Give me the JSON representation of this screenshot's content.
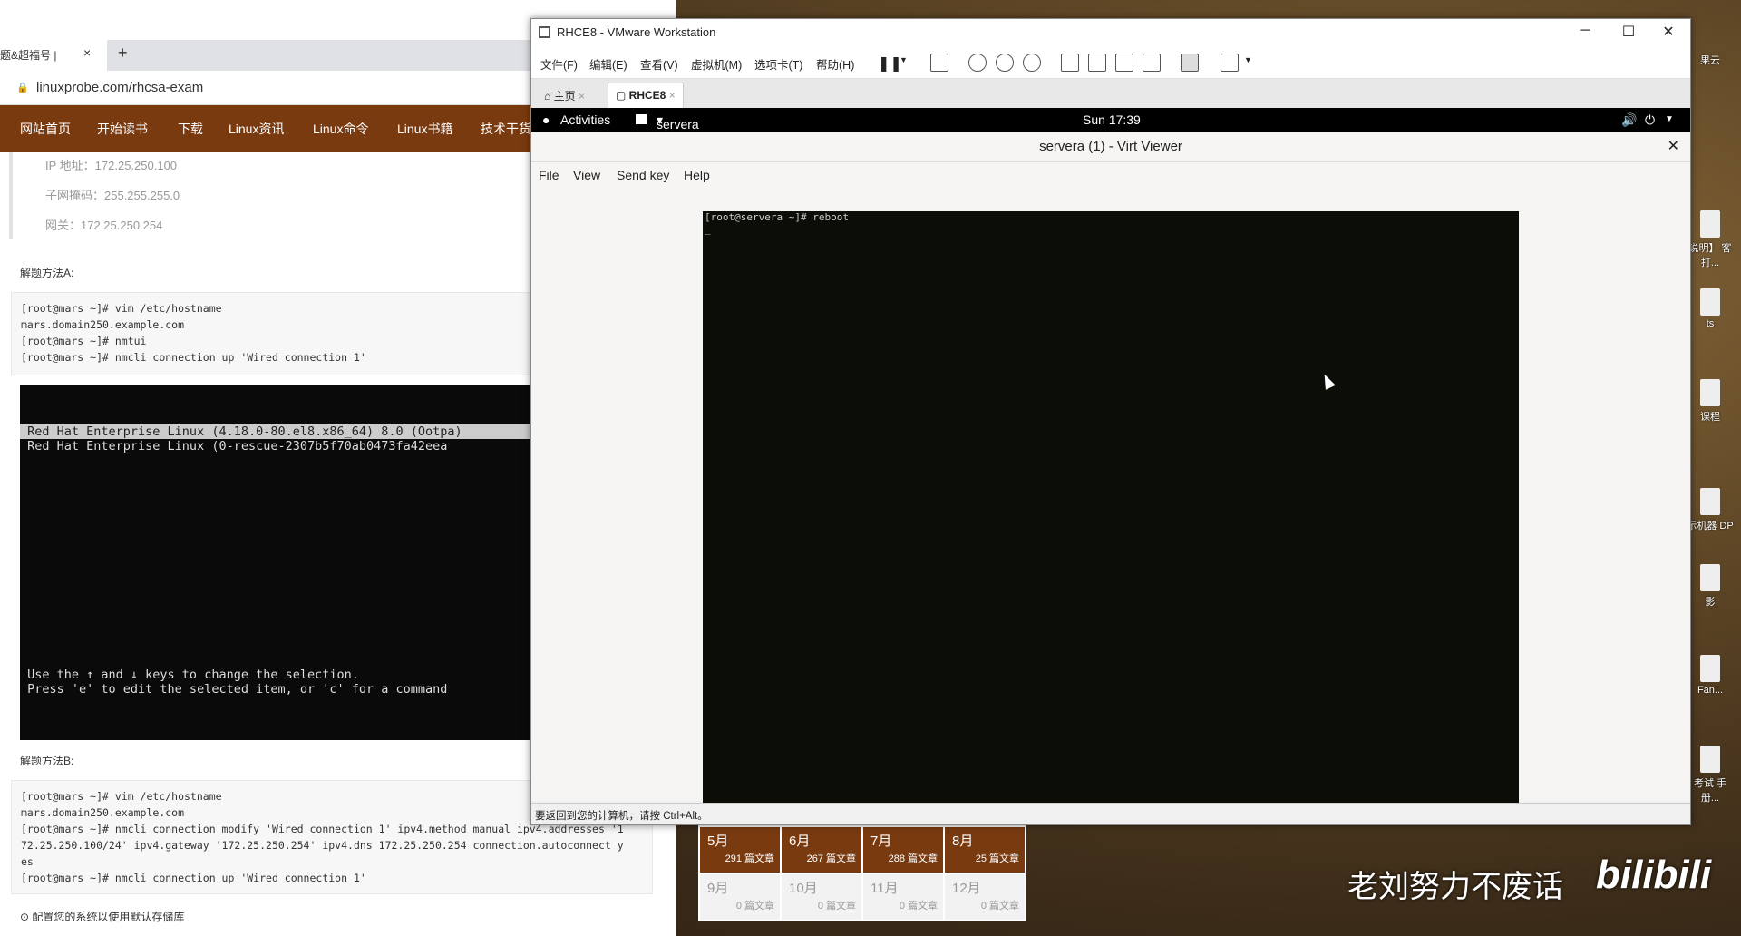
{
  "browser": {
    "tab_label": "题&超福号 |",
    "url": "linuxprobe.com/rhcsa-exam",
    "nav": [
      "网站首页",
      "开始读书",
      "下载",
      "Linux资讯",
      "Linux命令",
      "Linux书籍",
      "技术干货"
    ],
    "ip_rows": [
      "IP 地址：172.25.250.100",
      "子网掩码：255.255.255.0",
      "网关：172.25.250.254"
    ],
    "method_a_title": "解题方法A:",
    "method_a_code": "[root@mars ~]# vim /etc/hostname\nmars.domain250.example.com\n[root@mars ~]# nmtui\n[root@mars ~]# nmcli connection up 'Wired connection 1'",
    "grub_line1": " Red Hat Enterprise Linux (4.18.0-80.el8.x86_64) 8.0 (Ootpa)",
    "grub_line2": " Red Hat Enterprise Linux (0-rescue-2307b5f70ab0473fa42eea",
    "grub_help1": " Use the ↑ and ↓ keys to change the selection.",
    "grub_help2": " Press 'e' to edit the selected item, or 'c' for a command",
    "method_b_title": "解题方法B:",
    "method_b_code": "[root@mars ~]# vim /etc/hostname\nmars.domain250.example.com\n[root@mars ~]# nmcli connection modify 'Wired connection 1' ipv4.method manual ipv4.addresses '1\n72.25.250.100/24' ipv4.gateway '172.25.250.254' ipv4.dns 172.25.250.254 connection.autoconnect y\nes\n[root@mars ~]# nmcli connection up 'Wired connection 1'",
    "footer_note": "配置您的系统以使用默认存储库"
  },
  "calendar": [
    {
      "month": "5月",
      "count": "291 篇文章"
    },
    {
      "month": "6月",
      "count": "267 篇文章"
    },
    {
      "month": "7月",
      "count": "288 篇文章"
    },
    {
      "month": "8月",
      "count": "25 篇文章"
    },
    {
      "month": "9月",
      "count": "0 篇文章"
    },
    {
      "month": "10月",
      "count": "0 篇文章"
    },
    {
      "month": "11月",
      "count": "0 篇文章"
    },
    {
      "month": "12月",
      "count": "0 篇文章"
    }
  ],
  "vmware": {
    "title": "RHCE8 - VMware Workstation",
    "menu": [
      "文件(F)",
      "编辑(E)",
      "查看(V)",
      "虚拟机(M)",
      "选项卡(T)",
      "帮助(H)"
    ],
    "tabs": [
      "主页",
      "RHCE8"
    ],
    "status": "要返回到您的计算机，请按 Ctrl+Alt。"
  },
  "gnome": {
    "activities": "Activities",
    "app": "servera (1) - Virt Viewer",
    "clock": "Sun 17:39"
  },
  "virt_viewer": {
    "title": "servera (1) - Virt Viewer",
    "menu": [
      "File",
      "View",
      "Send key",
      "Help"
    ],
    "console_line": "[root@servera ~]# reboot",
    "console_cursor": "_"
  },
  "desktop": {
    "labels": [
      "果云",
      "说明】\n客打...",
      "ts",
      "课程",
      "示机器\nDP",
      "影",
      "Fan...",
      "考试\n手册..."
    ]
  },
  "watermark": {
    "text": "老刘努力不废话",
    "logo": "bilibili"
  }
}
